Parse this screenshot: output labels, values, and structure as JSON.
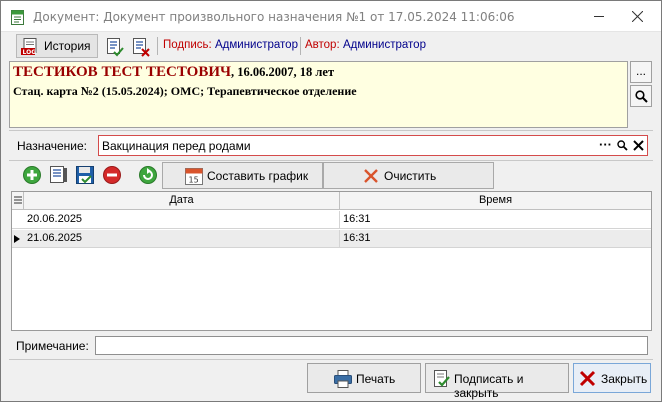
{
  "window": {
    "title": "Документ: Документ произвольного назначения №1 от 17.05.2024 11:06:06"
  },
  "toolbar": {
    "history_label": "История",
    "sign_label": "Подпись:",
    "sign_value": "Администратор",
    "author_label": "Автор:",
    "author_value": "Администратор"
  },
  "patient": {
    "name": "ТЕСТИКОВ ТЕСТ ТЕСТОВИЧ",
    "dob": ", 16.06.2007, 18 лет",
    "card": "Стац. карта №2 (15.05.2024); ОМС; Терапевтическое отделение",
    "more_label": "..."
  },
  "purpose": {
    "label": "Назначение:",
    "value": "Вакцинация перед родами",
    "ellipsis": "···"
  },
  "grid_toolbar": {
    "schedule_label": "Составить график",
    "clear_label": "Очистить"
  },
  "grid": {
    "columns": [
      "Дата",
      "Время"
    ],
    "rows": [
      {
        "date": "20.06.2025",
        "time": "16:31"
      },
      {
        "date": "21.06.2025",
        "time": "16:31"
      }
    ]
  },
  "note": {
    "label": "Примечание:",
    "value": ""
  },
  "buttons": {
    "print_label": "Печать",
    "sign_close_label": "Подписать и закрыть",
    "close_label": "Закрыть"
  },
  "colors": {
    "patient_name": "#990000",
    "patient_bg": "#ffffe1",
    "sign_red": "#c00000",
    "author_blue": "#00008b",
    "purpose_border": "#d44b4b"
  },
  "icons": [
    "app-icon",
    "log-history-icon",
    "sign-document-icon",
    "unsign-document-icon",
    "more-icon",
    "search-icon",
    "clear-icon",
    "add-icon",
    "edit-list-icon",
    "save-icon",
    "delete-icon",
    "refresh-icon",
    "calendar-icon",
    "clear-x-icon",
    "printer-icon",
    "sign-check-icon",
    "close-x-icon"
  ]
}
